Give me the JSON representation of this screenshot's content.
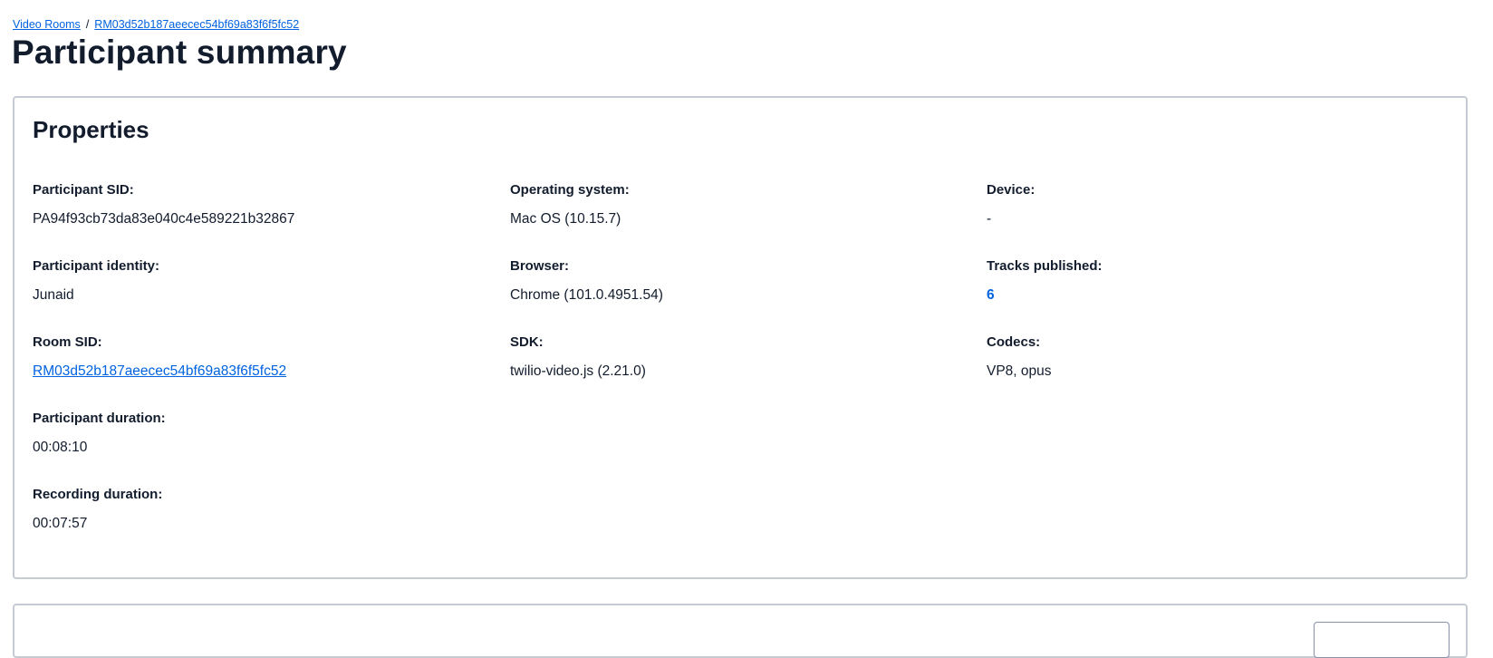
{
  "breadcrumb": {
    "root_label": "Video Rooms",
    "separator": "/",
    "room_label": "RM03d52b187aeecec54bf69a83f6f5fc52"
  },
  "page_title": "Participant summary",
  "properties": {
    "title": "Properties",
    "participant_sid": {
      "label": "Participant SID:",
      "value": "PA94f93cb73da83e040c4e589221b32867"
    },
    "participant_identity": {
      "label": "Participant identity:",
      "value": "Junaid"
    },
    "room_sid": {
      "label": "Room SID:",
      "value": "RM03d52b187aeecec54bf69a83f6f5fc52"
    },
    "participant_duration": {
      "label": "Participant duration:",
      "value": "00:08:10"
    },
    "recording_duration": {
      "label": "Recording duration:",
      "value": "00:07:57"
    },
    "operating_system": {
      "label": "Operating system:",
      "value": "Mac OS (10.15.7)"
    },
    "browser": {
      "label": "Browser:",
      "value": "Chrome (101.0.4951.54)"
    },
    "sdk": {
      "label": "SDK:",
      "value": "twilio-video.js (2.21.0)"
    },
    "device": {
      "label": "Device:",
      "value": "-"
    },
    "tracks_published": {
      "label": "Tracks published:",
      "value": "6"
    },
    "codecs": {
      "label": "Codecs:",
      "value": "VP8, opus"
    }
  },
  "colors": {
    "link": "#0263e0",
    "text": "#121c2d",
    "card_border": "#c5cad3"
  }
}
